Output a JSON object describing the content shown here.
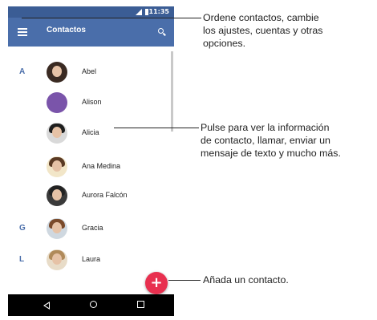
{
  "status_bar": {
    "time": "11:35"
  },
  "app_bar": {
    "title": "Contactos"
  },
  "contacts": [
    {
      "letter": "A",
      "name": "Abel"
    },
    {
      "letter": "",
      "name": "Alison"
    },
    {
      "letter": "",
      "name": "Alicia"
    },
    {
      "letter": "",
      "name": "Ana Medina"
    },
    {
      "letter": "",
      "name": "Aurora Falcón"
    },
    {
      "letter": "G",
      "name": "Gracia"
    },
    {
      "letter": "L",
      "name": "Laura"
    }
  ],
  "fab": {
    "label": "+"
  },
  "callouts": {
    "menu": "Ordene contactos, cambie\nlos ajustes, cuentas y otras\nopciones.",
    "contact": "Pulse para ver la información\nde contacto, llamar, enviar un\nmensaje de texto y mucho más.",
    "add": "Añada un contacto."
  },
  "colors": {
    "app_bar": "#4a6eaa",
    "status_bar": "#3b5d95",
    "accent_letter": "#4a6eaa",
    "fab": "#e8304f",
    "alison_avatar": "#7a54aa"
  }
}
